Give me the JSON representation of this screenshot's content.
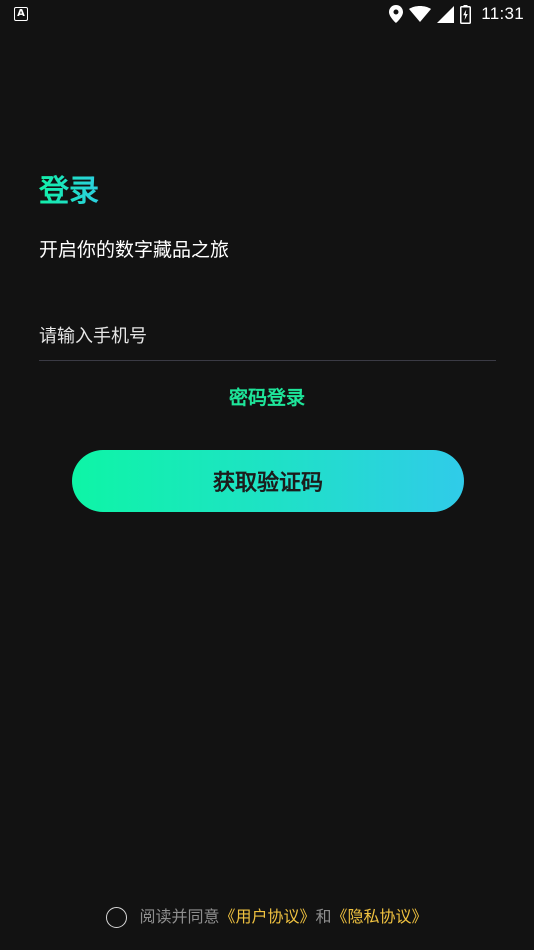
{
  "status_bar": {
    "notification_icon": "A",
    "time": "11:31",
    "icons": [
      "location-icon",
      "wifi-icon",
      "signal-icon",
      "battery-charging-icon"
    ]
  },
  "login": {
    "title": "登录",
    "subtitle": "开启你的数字藏品之旅",
    "phone_placeholder": "请输入手机号",
    "phone_value": "",
    "password_login_label": "密码登录",
    "get_code_label": "获取验证码"
  },
  "agreement": {
    "prefix": "阅读并同意",
    "user_agreement": "《用户协议》",
    "conjunction": "和",
    "privacy_agreement": "《隐私协议》",
    "checked": false
  },
  "colors": {
    "background": "#121212",
    "accent_start": "#0ef5a6",
    "accent_end": "#30cbe9",
    "link_gold": "#f0c240",
    "muted_text": "#8e8e8e"
  }
}
